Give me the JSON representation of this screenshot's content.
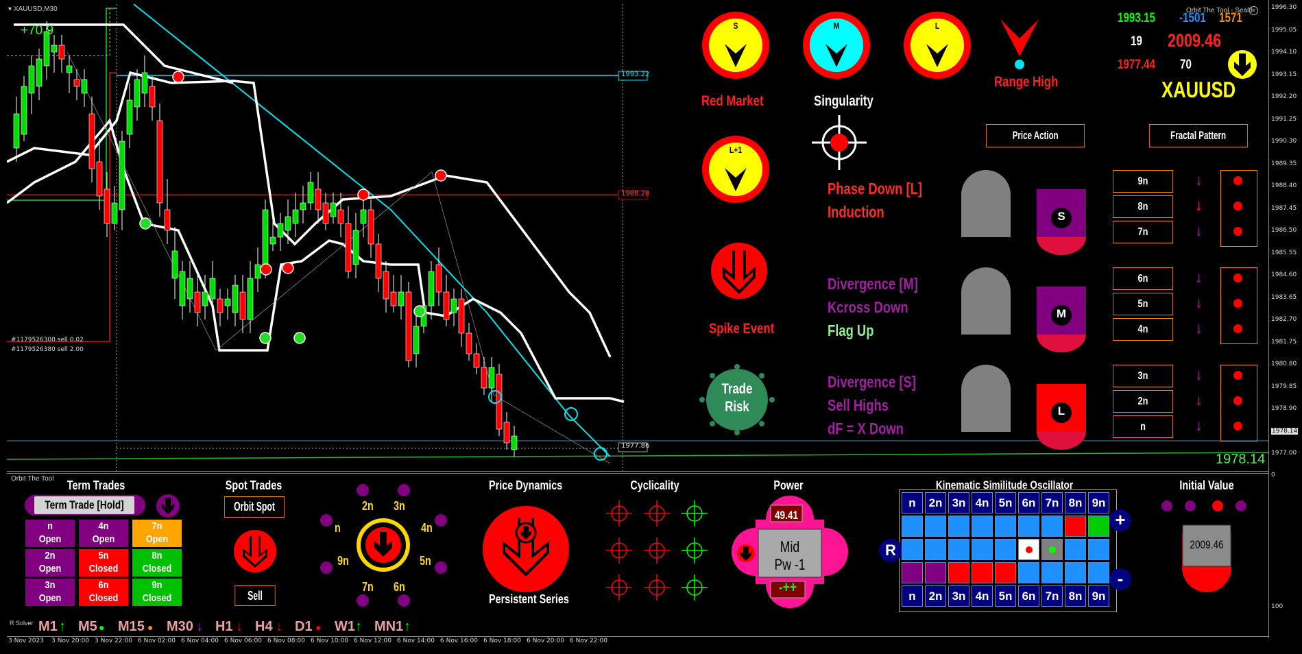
{
  "window": {
    "title": "XAUUSD,M30",
    "corner_label": "Orbit The Tool - Seal3"
  },
  "chart": {
    "profit_label": "+70.9",
    "order1": "#1179526300 sell 0.02",
    "order2": "#1179526380 sell 2.00",
    "level_1993": "1993.22",
    "level_1988": "1988.28",
    "level_1977": "1977.86",
    "current_price_big": "1978.14",
    "price_axis": [
      "1996.30",
      "1995.05",
      "1994.10",
      "1993.15",
      "1992.20",
      "1991.25",
      "1990.30",
      "1989.35",
      "1988.40",
      "1987.45",
      "1986.50",
      "1985.55",
      "1984.60",
      "1983.65",
      "1982.70",
      "1981.75",
      "1980.80",
      "1979.85",
      "1978.90",
      "1978.14",
      "1977.00"
    ],
    "sub_axis": [
      "0",
      "100"
    ],
    "time_axis": [
      "3 Nov 2023",
      "3 Nov 20:00",
      "3 Nov 22:00",
      "6 Nov 02:00",
      "6 Nov 04:00",
      "6 Nov 06:00",
      "6 Nov 08:00",
      "6 Nov 10:00",
      "6 Nov 12:00",
      "6 Nov 14:00",
      "6 Nov 16:00",
      "6 Nov 18:00",
      "6 Nov 20:00",
      "6 Nov 22:00"
    ]
  },
  "dashboard": {
    "circles": [
      {
        "letter": "S",
        "color": "#ffff00"
      },
      {
        "letter": "M",
        "color": "#00ffff"
      },
      {
        "letter": "L",
        "color": "#ffff00"
      },
      {
        "letter": "L+1",
        "color": "#ffff00"
      }
    ],
    "red_market": "Red Market",
    "singularity": "Singularity",
    "range_high": "Range High",
    "spike_event": "Spike Event",
    "trade_risk_1": "Trade",
    "trade_risk_2": "Risk",
    "stats": {
      "v1": "1993.15",
      "v2": "-1501",
      "v3": "1571",
      "v4": "19",
      "v5": "2009.46",
      "v6": "1977.44",
      "v7": "70"
    },
    "symbol": "XAUUSD",
    "price_action": "Price Action",
    "fractal_pattern": "Fractal Pattern",
    "phase_lines": [
      {
        "text": "Phase Down [L]",
        "color": "#ff2a2a"
      },
      {
        "text": "Induction",
        "color": "#ff2a2a"
      },
      {
        "text": "Divergence [M]",
        "color": "#a020a0"
      },
      {
        "text": "Kcross Down",
        "color": "#a020a0"
      },
      {
        "text": "Flag Up",
        "color": "#90ee90"
      },
      {
        "text": "Divergence [S]",
        "color": "#a020a0"
      },
      {
        "text": "Sell Highs",
        "color": "#a020a0"
      },
      {
        "text": "dF = X Down",
        "color": "#a020a0"
      }
    ],
    "cycle_badges": [
      "S",
      "M",
      "L"
    ],
    "fractal_labels": [
      "9n",
      "8n",
      "7n",
      "6n",
      "5n",
      "4n",
      "3n",
      "2n",
      "n"
    ]
  },
  "bottom": {
    "panel_title": "Orbit The Tool",
    "term_trades": "Term Trades",
    "term_trade_hold": "Term Trade [Hold]",
    "tt_cells": [
      {
        "l1": "n",
        "l2": "Open",
        "bg": "#800080"
      },
      {
        "l1": "4n",
        "l2": "Open",
        "bg": "#800080"
      },
      {
        "l1": "7n",
        "l2": "Open",
        "bg": "#ffa500"
      },
      {
        "l1": "2n",
        "l2": "Open",
        "bg": "#800080"
      },
      {
        "l1": "5n",
        "l2": "Closed",
        "bg": "#ff0000"
      },
      {
        "l1": "8n",
        "l2": "Closed",
        "bg": "#00c000"
      },
      {
        "l1": "3n",
        "l2": "Open",
        "bg": "#800080"
      },
      {
        "l1": "6n",
        "l2": "Closed",
        "bg": "#ff0000"
      },
      {
        "l1": "9n",
        "l2": "Closed",
        "bg": "#00c000"
      }
    ],
    "spot_trades": "Spot Trades",
    "orbit_spot": "Orbit Spot",
    "sell": "Sell",
    "orbit_labels": [
      "2n",
      "3n",
      "4n",
      "5n",
      "6n",
      "7n",
      "9n",
      "n"
    ],
    "price_dynamics": "Price Dynamics",
    "persistent_series": "Persistent Series",
    "cyclicality": "Cyclicality",
    "power": "Power",
    "power_value": "49.41",
    "power_mid1": "Mid",
    "power_mid2": "Pw -1",
    "power_signs": "-++",
    "kso_title": "Kinematic Similitude Oscillator",
    "kso_headers": [
      "n",
      "2n",
      "3n",
      "4n",
      "5n",
      "6n",
      "7n",
      "8n",
      "9n"
    ],
    "kso_plus": "+",
    "kso_minus": "-",
    "kso_r": "R",
    "initial_value": "Initial Value",
    "initial_value_num": "2009.46",
    "solver_label": "R Solver",
    "timeframes": [
      {
        "tf": "M1",
        "sig": "↑",
        "color": "#00ff00"
      },
      {
        "tf": "M5",
        "sig": "●",
        "color": "#00ff00"
      },
      {
        "tf": "M15",
        "sig": "●",
        "color": "#ff8c00"
      },
      {
        "tf": "M30",
        "sig": "↓",
        "color": "#a020f0"
      },
      {
        "tf": "H1",
        "sig": "↓",
        "color": "#ff0000"
      },
      {
        "tf": "H4",
        "sig": "↓",
        "color": "#ff0000"
      },
      {
        "tf": "D1",
        "sig": "●",
        "color": "#ff0000"
      },
      {
        "tf": "W1",
        "sig": "↑",
        "color": "#00ff00"
      },
      {
        "tf": "MN1",
        "sig": "↑",
        "color": "#00ff00"
      }
    ]
  }
}
